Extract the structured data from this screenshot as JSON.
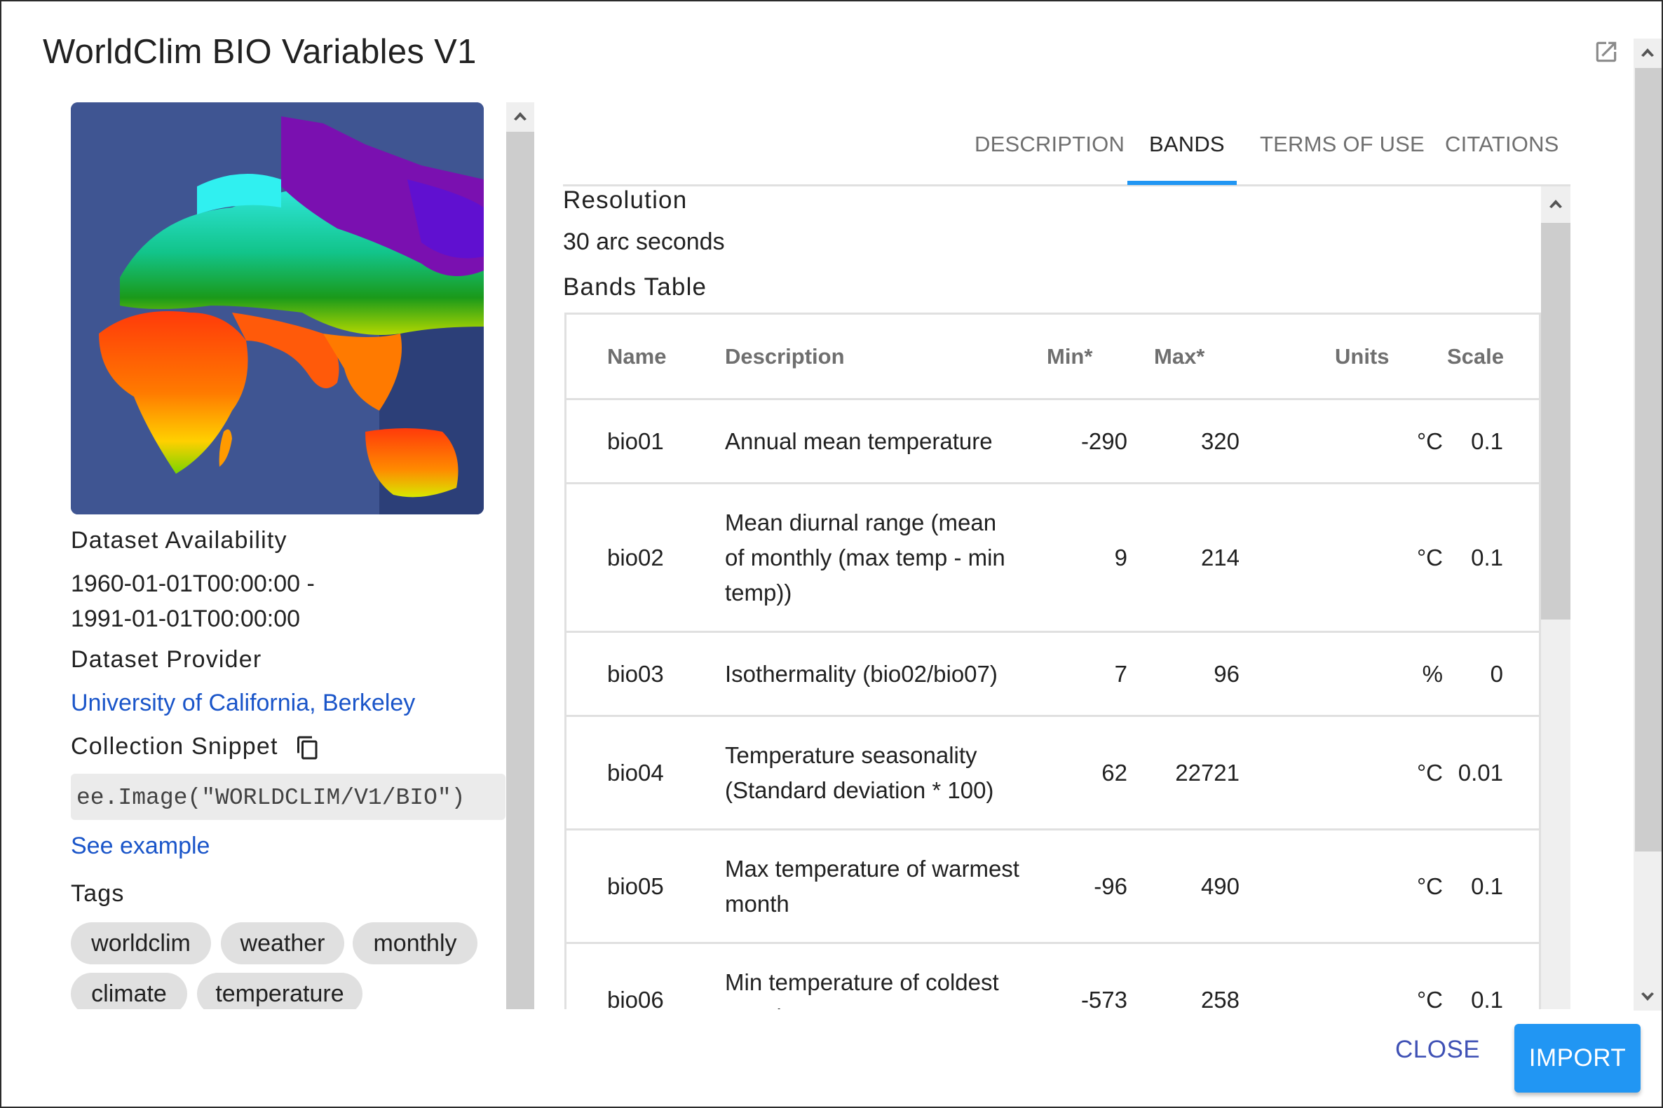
{
  "dialog": {
    "title": "WorldClim BIO Variables V1",
    "open_external_icon": "open-in-new-icon"
  },
  "left": {
    "thumbnail_alt": "Global map of annual mean temperature",
    "availability_label": "Dataset Availability",
    "availability_start": "1960-01-01T00:00:00 -",
    "availability_end": "1991-01-01T00:00:00",
    "provider_label": "Dataset Provider",
    "provider_link": "University of California, Berkeley",
    "snippet_label": "Collection Snippet",
    "copy_icon": "copy-icon",
    "snippet_code": "ee.Image(\"WORLDCLIM/V1/BIO\")",
    "see_example": "See example",
    "tags_label": "Tags",
    "tags": [
      "worldclim",
      "weather",
      "monthly",
      "climate",
      "temperature"
    ]
  },
  "tabs": [
    {
      "label": "DESCRIPTION",
      "active": false
    },
    {
      "label": "BANDS",
      "active": true
    },
    {
      "label": "TERMS OF USE",
      "active": false
    },
    {
      "label": "CITATIONS",
      "active": false
    }
  ],
  "bands": {
    "resolution_label": "Resolution",
    "resolution_value": "30 arc seconds",
    "table_label": "Bands Table",
    "columns": [
      "Name",
      "Description",
      "Min*",
      "Max*",
      "Units",
      "Scale"
    ],
    "rows": [
      {
        "name": "bio01",
        "description": "Annual mean temperature",
        "min": "-290",
        "max": "320",
        "units": "°C",
        "scale": "0.1"
      },
      {
        "name": "bio02",
        "description": "Mean diurnal range (mean of monthly (max temp - min temp))",
        "min": "9",
        "max": "214",
        "units": "°C",
        "scale": "0.1"
      },
      {
        "name": "bio03",
        "description": "Isothermality (bio02/bio07)",
        "min": "7",
        "max": "96",
        "units": "%",
        "scale": "0"
      },
      {
        "name": "bio04",
        "description": "Temperature seasonality (Standard deviation * 100)",
        "min": "62",
        "max": "22721",
        "units": "°C",
        "scale": "0.01"
      },
      {
        "name": "bio05",
        "description": "Max temperature of warmest month",
        "min": "-96",
        "max": "490",
        "units": "°C",
        "scale": "0.1"
      },
      {
        "name": "bio06",
        "description": "Min temperature of coldest month",
        "min": "-573",
        "max": "258",
        "units": "°C",
        "scale": "0.1"
      }
    ]
  },
  "footer": {
    "close_label": "CLOSE",
    "import_label": "IMPORT"
  },
  "colors": {
    "accent": "#2196f3",
    "link": "#1a55c9",
    "close_text": "#3f51b5"
  }
}
